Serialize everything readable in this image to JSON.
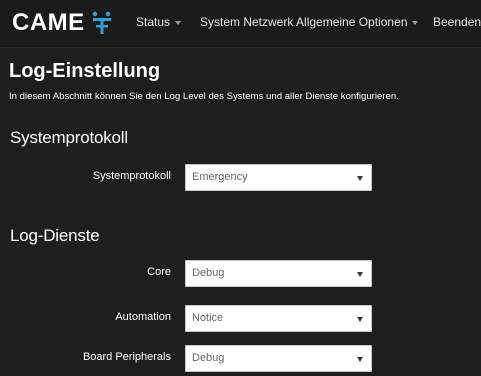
{
  "navbar": {
    "brand": "CAME",
    "brand_icon": "came-logo-icon",
    "items": [
      {
        "label": "Status",
        "has_dropdown": true
      },
      {
        "label": "System Netzwerk Allgemeine Optionen",
        "has_dropdown": true
      },
      {
        "label": "Beenden",
        "has_dropdown": false
      }
    ]
  },
  "page": {
    "title": "Log-Einstellung",
    "description": "In diesem Abschnitt können Sie den Log Level des Systems und aller Dienste konfigurieren."
  },
  "system_section": {
    "title": "Systemprotokoll",
    "fields": [
      {
        "label": "Systemprotokoll",
        "value": "Emergency"
      }
    ]
  },
  "services_section": {
    "title": "Log-Dienste",
    "fields": [
      {
        "label": "Core",
        "value": "Debug"
      },
      {
        "label": "Automation",
        "value": "Notice"
      },
      {
        "label": "Board Peripherals",
        "value": "Debug"
      }
    ]
  },
  "colors": {
    "background": "#1e1e1e",
    "navbar": "#1b1b1b",
    "logo_accent": "#2aa3dc",
    "select_background": "#ffffff",
    "select_text": "#666666"
  }
}
